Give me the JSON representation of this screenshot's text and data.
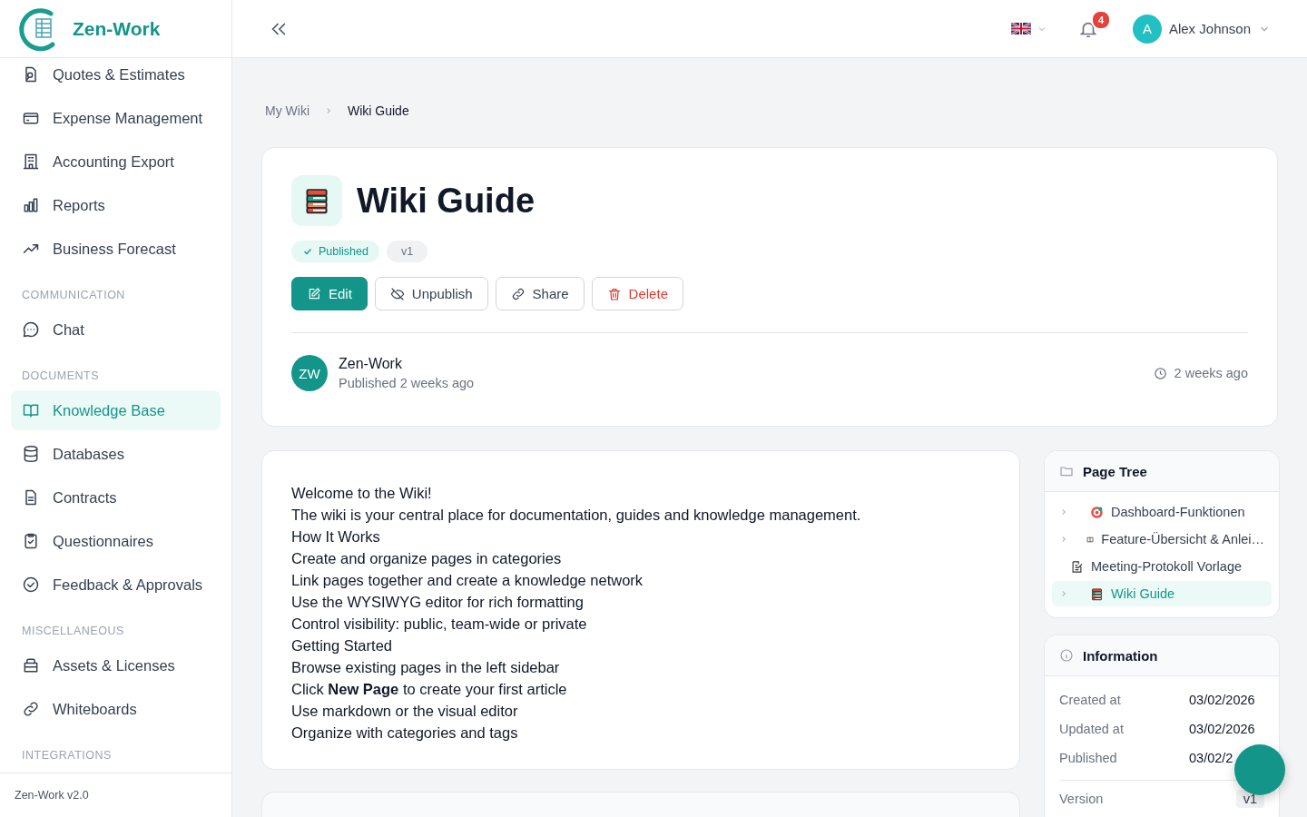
{
  "brand": {
    "name": "Zen-Work"
  },
  "sidebar": {
    "items": [
      {
        "kind": "item",
        "label": "Quotes & Estimates",
        "selected": false
      },
      {
        "kind": "item",
        "label": "Expense Management",
        "selected": false
      },
      {
        "kind": "item",
        "label": "Accounting Export",
        "selected": false
      },
      {
        "kind": "item",
        "label": "Reports",
        "selected": false
      },
      {
        "kind": "item",
        "label": "Business Forecast",
        "selected": false
      },
      {
        "kind": "section",
        "label": "COMMUNICATION"
      },
      {
        "kind": "item",
        "label": "Chat",
        "selected": false
      },
      {
        "kind": "section",
        "label": "DOCUMENTS"
      },
      {
        "kind": "item",
        "label": "Knowledge Base",
        "selected": true
      },
      {
        "kind": "item",
        "label": "Databases",
        "selected": false
      },
      {
        "kind": "item",
        "label": "Contracts",
        "selected": false
      },
      {
        "kind": "item",
        "label": "Questionnaires",
        "selected": false
      },
      {
        "kind": "item",
        "label": "Feedback & Approvals",
        "selected": false
      },
      {
        "kind": "section",
        "label": "MISCELLANEOUS"
      },
      {
        "kind": "item",
        "label": "Assets & Licenses",
        "selected": false
      },
      {
        "kind": "item",
        "label": "Whiteboards",
        "selected": false
      },
      {
        "kind": "section",
        "label": "INTEGRATIONS"
      }
    ],
    "footer": "Zen-Work v2.0"
  },
  "topbar": {
    "notifications": "4",
    "user": {
      "initial": "A",
      "name": "Alex Johnson"
    }
  },
  "breadcrumb": [
    {
      "label": "My Wiki",
      "selected": false
    },
    {
      "label": "Wiki Guide",
      "selected": true
    }
  ],
  "page": {
    "title": "Wiki Guide",
    "status": "Published",
    "version": "v1",
    "actions": [
      {
        "kind": "primary",
        "label": "Edit"
      },
      {
        "kind": "outline",
        "label": "Unpublish"
      },
      {
        "kind": "outline",
        "label": "Share"
      },
      {
        "kind": "danger",
        "label": "Delete"
      }
    ],
    "author": {
      "initials": "ZW",
      "name": "Zen-Work",
      "meta": "Published 2 weeks ago"
    },
    "time": "2 weeks ago"
  },
  "content": [
    "Welcome to the Wiki!",
    "The wiki is your central place for documentation, guides and knowledge management.",
    "How It Works",
    "Create and organize pages in categories",
    "Link pages together and create a knowledge network",
    "Use the WYSIWYG editor for rich formatting",
    "Control visibility: public, team-wide or private",
    "Getting Started",
    "Browse existing pages in the left sidebar",
    "Click **New Page** to create your first article",
    "Use markdown or the visual editor",
    "Organize with categories and tags"
  ],
  "page_tree": {
    "title": "Page Tree",
    "items": [
      {
        "label": "Dashboard-Funktionen",
        "expandable": true,
        "selected": false
      },
      {
        "label": "Feature-Übersicht & Anlei…",
        "expandable": true,
        "selected": false
      },
      {
        "label": "Meeting-Protokoll Vorlage",
        "expandable": false,
        "selected": false
      },
      {
        "label": "Wiki Guide",
        "expandable": true,
        "selected": true
      }
    ]
  },
  "information": {
    "title": "Information",
    "rows": [
      {
        "kind": "text",
        "label": "Created at",
        "value": "03/02/2026"
      },
      {
        "kind": "text",
        "label": "Updated at",
        "value": "03/02/2026"
      },
      {
        "kind": "text",
        "label": "Published",
        "value": "03/02/2"
      },
      {
        "kind": "badge",
        "label": "Version",
        "value": "v1"
      }
    ]
  }
}
